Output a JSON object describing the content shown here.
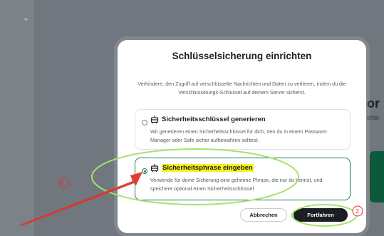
{
  "left_rail": {
    "plus": "+"
  },
  "background": {
    "big_text": "or",
    "small_text": "erlei"
  },
  "dialog": {
    "title": "Schlüsselsicherung einrichten",
    "description": "Verhindere, den Zugriff auf verschlüsselte Nachrichten und Daten zu verlieren, indem du die Verschlüsselungs-Schlüssel auf deinem Server sicherst.",
    "options": [
      {
        "title": "Sicherheitsschlüssel generieren",
        "description": "Wir generieren einen Sicherheitsschlüssel für dich, den du in einem Passwort-Manager oder Safe sicher aufbewahren solltest.",
        "selected": false,
        "icon": "safe-icon"
      },
      {
        "title": "Sicherheitsphrase eingeben",
        "description": "Verwende für deine Sicherung eine geheime Phrase, die nur du kennst, und speichere optional einen Sicherheitsschlüssel.",
        "selected": true,
        "icon": "safe-icon"
      }
    ],
    "cancel_label": "Abbrechen",
    "continue_label": "Fortfahren"
  },
  "annotations": {
    "step_1": "1.",
    "step_2": "2"
  },
  "colors": {
    "accent_green": "#1f7a53",
    "highlight_yellow": "#f7f418",
    "annotation_red": "#e0342a",
    "annotation_green": "#a6e36a"
  }
}
